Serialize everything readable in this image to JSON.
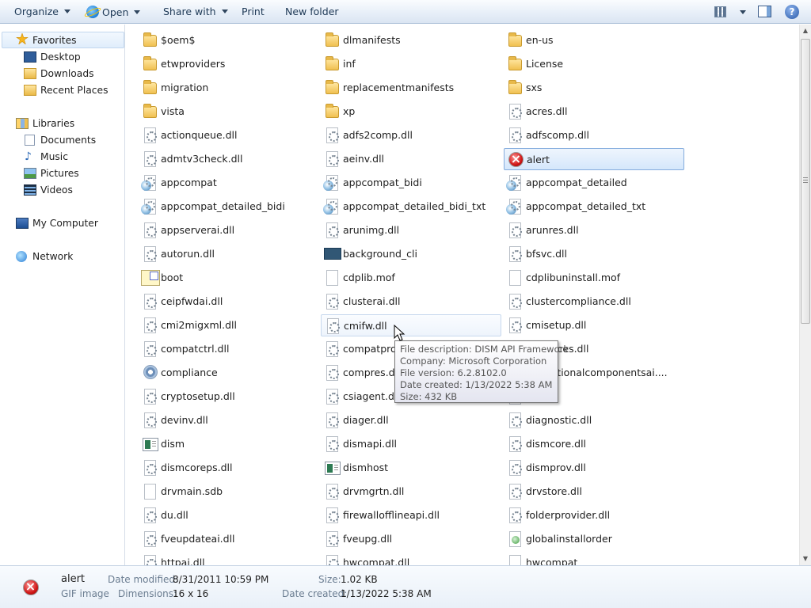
{
  "toolbar": {
    "organize": "Organize",
    "open": "Open",
    "share_with": "Share with",
    "print": "Print",
    "new_folder": "New folder"
  },
  "sidebar": {
    "favorites": "Favorites",
    "desktop": "Desktop",
    "downloads": "Downloads",
    "recent_places": "Recent Places",
    "libraries": "Libraries",
    "documents": "Documents",
    "music": "Music",
    "pictures": "Pictures",
    "videos": "Videos",
    "my_computer": "My Computer",
    "network": "Network"
  },
  "files": [
    {
      "name": "$oem$",
      "icon": "folder-icon"
    },
    {
      "name": "dlmanifests",
      "icon": "folder-icon"
    },
    {
      "name": "en-us",
      "icon": "folder-icon"
    },
    {
      "name": "etwproviders",
      "icon": "folder-icon"
    },
    {
      "name": "inf",
      "icon": "folder-icon"
    },
    {
      "name": "License",
      "icon": "folder-icon"
    },
    {
      "name": "migration",
      "icon": "folder-icon"
    },
    {
      "name": "replacementmanifests",
      "icon": "folder-icon"
    },
    {
      "name": "sxs",
      "icon": "folder-icon"
    },
    {
      "name": "vista",
      "icon": "folder-icon"
    },
    {
      "name": "xp",
      "icon": "folder-icon"
    },
    {
      "name": "acres.dll",
      "icon": "dll-icon"
    },
    {
      "name": "actionqueue.dll",
      "icon": "dll-icon"
    },
    {
      "name": "adfs2comp.dll",
      "icon": "dll-icon"
    },
    {
      "name": "adfscomp.dll",
      "icon": "dll-icon"
    },
    {
      "name": "admtv3check.dll",
      "icon": "dll-icon"
    },
    {
      "name": "aeinv.dll",
      "icon": "dll-icon"
    },
    {
      "name": "alert",
      "icon": "alert-icon"
    },
    {
      "name": "appcompat",
      "icon": "executable-icon"
    },
    {
      "name": "appcompat_bidi",
      "icon": "executable-icon"
    },
    {
      "name": "appcompat_detailed",
      "icon": "executable-icon"
    },
    {
      "name": "appcompat_detailed_bidi",
      "icon": "executable-icon"
    },
    {
      "name": "appcompat_detailed_bidi_txt",
      "icon": "executable-icon"
    },
    {
      "name": "appcompat_detailed_txt",
      "icon": "executable-icon"
    },
    {
      "name": "appserverai.dll",
      "icon": "dll-icon"
    },
    {
      "name": "arunimg.dll",
      "icon": "dll-icon"
    },
    {
      "name": "arunres.dll",
      "icon": "dll-icon"
    },
    {
      "name": "autorun.dll",
      "icon": "dll-icon"
    },
    {
      "name": "background_cli",
      "icon": "bitmap-icon"
    },
    {
      "name": "bfsvc.dll",
      "icon": "dll-icon"
    },
    {
      "name": "boot",
      "icon": "boot-icon"
    },
    {
      "name": "cdplib.mof",
      "icon": "blank-file-icon"
    },
    {
      "name": "cdplibuninstall.mof",
      "icon": "blank-file-icon"
    },
    {
      "name": "ceipfwdai.dll",
      "icon": "dll-icon"
    },
    {
      "name": "clusterai.dll",
      "icon": "dll-icon"
    },
    {
      "name": "clustercompliance.dll",
      "icon": "dll-icon"
    },
    {
      "name": "cmi2migxml.dll",
      "icon": "dll-icon"
    },
    {
      "name": "cmifw.dll",
      "icon": "dll-icon"
    },
    {
      "name": "cmisetup.dll",
      "icon": "dll-icon"
    },
    {
      "name": "compatctrl.dll",
      "icon": "dll-icon"
    },
    {
      "name": "compatprov",
      "icon": "dll-icon"
    },
    {
      "name": "resources.dll",
      "icon": "dll-icon"
    },
    {
      "name": "compliance",
      "icon": "gear-icon"
    },
    {
      "name": "compres.dll",
      "icon": "dll-icon"
    },
    {
      "name": "reieoptionalcomponentsai....",
      "icon": "dll-icon"
    },
    {
      "name": "cryptosetup.dll",
      "icon": "dll-icon"
    },
    {
      "name": "csiagent.dll",
      "icon": "dll-icon"
    },
    {
      "name": "",
      "icon": "dll-icon"
    },
    {
      "name": "devinv.dll",
      "icon": "dll-icon"
    },
    {
      "name": "diager.dll",
      "icon": "dll-icon"
    },
    {
      "name": "diagnostic.dll",
      "icon": "dll-icon"
    },
    {
      "name": "dism",
      "icon": "application-icon"
    },
    {
      "name": "dismapi.dll",
      "icon": "dll-icon"
    },
    {
      "name": "dismcore.dll",
      "icon": "dll-icon"
    },
    {
      "name": "dismcoreps.dll",
      "icon": "dll-icon"
    },
    {
      "name": "dismhost",
      "icon": "application-icon"
    },
    {
      "name": "dismprov.dll",
      "icon": "dll-icon"
    },
    {
      "name": "drvmain.sdb",
      "icon": "blank-file-icon"
    },
    {
      "name": "drvmgrtn.dll",
      "icon": "dll-icon"
    },
    {
      "name": "drvstore.dll",
      "icon": "dll-icon"
    },
    {
      "name": "du.dll",
      "icon": "dll-icon"
    },
    {
      "name": "firewallofflineapi.dll",
      "icon": "dll-icon"
    },
    {
      "name": "folderprovider.dll",
      "icon": "dll-icon"
    },
    {
      "name": "fveupdateai.dll",
      "icon": "dll-icon"
    },
    {
      "name": "fveupg.dll",
      "icon": "dll-icon"
    },
    {
      "name": "globalinstallorder",
      "icon": "web-document-icon"
    },
    {
      "name": "httpai.dll",
      "icon": "dll-icon"
    },
    {
      "name": "hwcompat.dll",
      "icon": "dll-icon"
    },
    {
      "name": "hwcompat",
      "icon": "blank-file-icon"
    }
  ],
  "tooltip": {
    "description": "File description: DISM API Framework",
    "company": "Company: Microsoft Corporation",
    "version": "File version: 6.2.8102.0",
    "created": "Date created: 1/13/2022 5:38 AM",
    "size": "Size: 432 KB"
  },
  "details": {
    "name": "alert",
    "type": "GIF image",
    "modified_label": "Date modified:",
    "modified_value": "8/31/2011 10:59 PM",
    "dimensions_label": "Dimensions:",
    "dimensions_value": "16 x 16",
    "size_label": "Size:",
    "size_value": "1.02 KB",
    "created_label": "Date created:",
    "created_value": "1/13/2022 5:38 AM"
  }
}
